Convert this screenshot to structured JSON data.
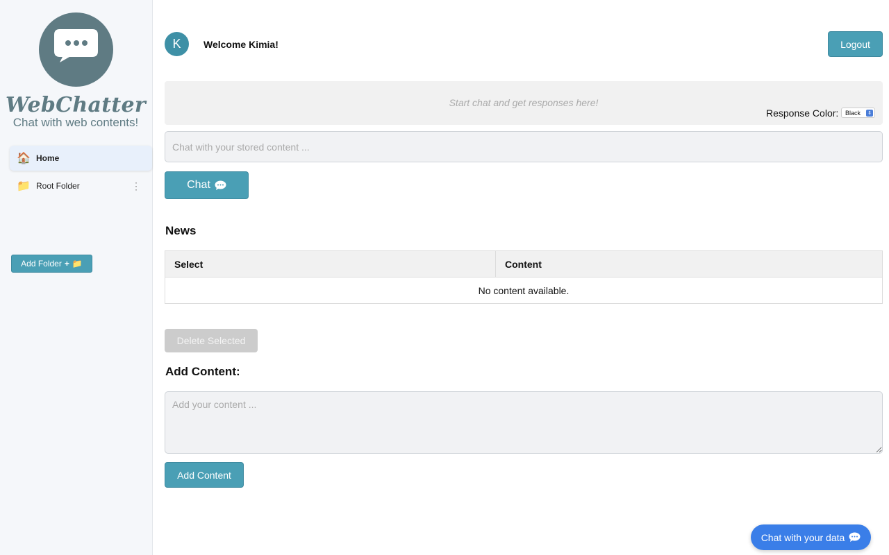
{
  "sidebar": {
    "logo": {
      "title": "WebChatter",
      "subtitle": "Chat with web contents!"
    },
    "items": [
      {
        "label": "Home",
        "icon": "house-icon",
        "active": true
      },
      {
        "label": "Root Folder",
        "icon": "folder-icon",
        "active": false
      }
    ],
    "add_folder_label": "Add Folder"
  },
  "header": {
    "avatar_letter": "K",
    "welcome": "Welcome Kimia!",
    "logout_label": "Logout"
  },
  "chat": {
    "response_placeholder": "Start chat and get responses here!",
    "response_color_label": "Response Color:",
    "response_color_value": "Black",
    "input_placeholder": "Chat with your stored content ...",
    "chat_label": "Chat"
  },
  "news": {
    "title": "News",
    "columns": [
      "Select",
      "Content"
    ],
    "empty_message": "No content available.",
    "delete_label": "Delete Selected"
  },
  "add_content": {
    "title": "Add Content:",
    "placeholder": "Add your content ...",
    "button_label": "Add Content"
  },
  "floating": {
    "label": "Chat with your data"
  },
  "colors": {
    "accent": "#4a9fb5",
    "logo": "#5f7b83",
    "float": "#3a7ee8"
  }
}
